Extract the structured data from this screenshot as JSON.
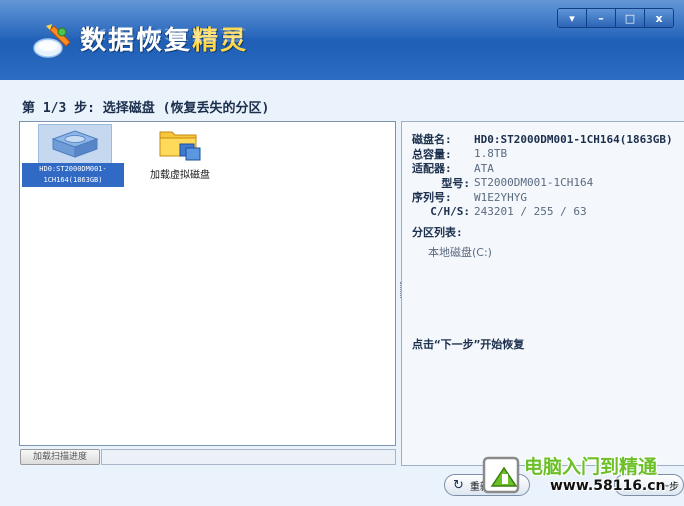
{
  "app": {
    "title_main": "数据恢复",
    "title_accent": "精灵",
    "window_controls": [
      "▾",
      "–",
      "□",
      "x"
    ]
  },
  "step": {
    "title": "第 1/3 步: 选择磁盘 (恢复丢失的分区)"
  },
  "left_pane": {
    "disk_label": "HD0:ST2000DM001-1CH164(1863GB)",
    "virtual_disk_label": "加载虚拟磁盘",
    "icons": {
      "disk": "hard-disk-icon",
      "virtual_disk": "folder-virtual-disk-icon"
    }
  },
  "disk_info": {
    "rows": [
      {
        "key": "磁盘名:",
        "value": "HD0:ST2000DM001-1CH164(1863GB)"
      },
      {
        "key": "总容量:",
        "value": "1.8TB"
      },
      {
        "key": "适配器:",
        "value": "ATA"
      },
      {
        "key": "型号:",
        "value": "ST2000DM001-1CH164"
      },
      {
        "key": "序列号:",
        "value": "W1E2YHYG"
      },
      {
        "key": "C/H/S:",
        "value": "243201 / 255 / 63"
      }
    ],
    "partition_list_title": "分区列表:",
    "partitions": [
      "本地磁盘(C:)"
    ],
    "hint": "点击“下一步”开始恢复"
  },
  "progress": {
    "scan_button_label": "加载扫描进度",
    "value": 0
  },
  "nav": {
    "prev_label": "重新",
    "next_label": "一步"
  },
  "watermark": {
    "line1": "电脑入门到精通",
    "line2": "www.58116.cn"
  },
  "colors": {
    "banner": "#1f5fb6",
    "selection": "#316ac5",
    "title_accent": "#ffd84a",
    "watermark_green": "#6bbf27"
  }
}
